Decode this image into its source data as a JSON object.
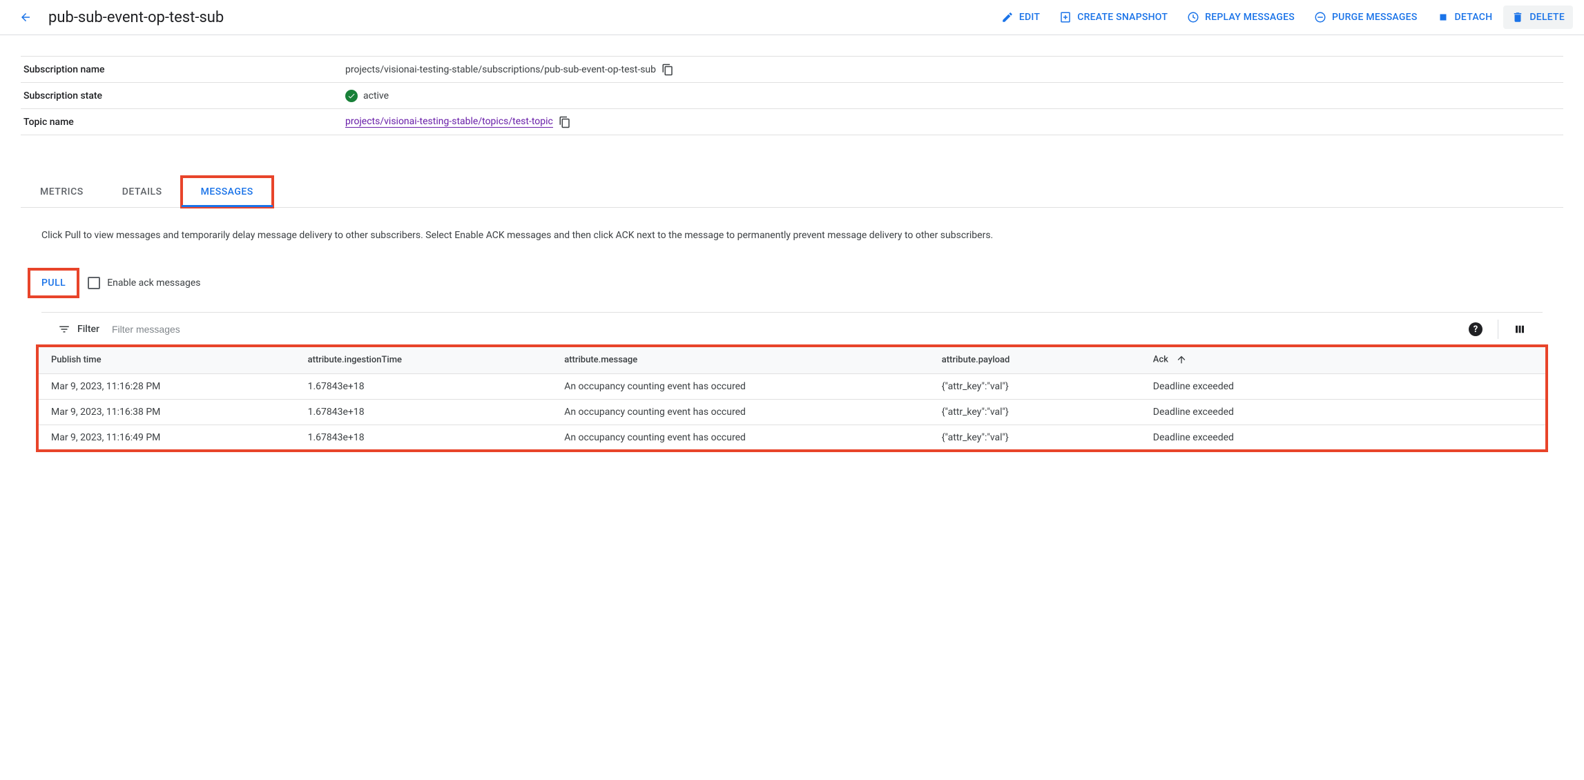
{
  "header": {
    "title": "pub-sub-event-op-test-sub",
    "actions": {
      "edit": "EDIT",
      "snapshot": "CREATE SNAPSHOT",
      "replay": "REPLAY MESSAGES",
      "purge": "PURGE MESSAGES",
      "detach": "DETACH",
      "delete": "DELETE"
    }
  },
  "details": {
    "subscription_name_label": "Subscription name",
    "subscription_name_value": "projects/visionai-testing-stable/subscriptions/pub-sub-event-op-test-sub",
    "subscription_state_label": "Subscription state",
    "subscription_state_value": "active",
    "topic_name_label": "Topic name",
    "topic_name_value": "projects/visionai-testing-stable/topics/test-topic"
  },
  "tabs": {
    "metrics": "METRICS",
    "details": "DETAILS",
    "messages": "MESSAGES"
  },
  "messages_tab": {
    "help_text": "Click Pull to view messages and temporarily delay message delivery to other subscribers. Select Enable ACK messages and then click ACK next to the message to permanently prevent message delivery to other subscribers.",
    "pull_label": "PULL",
    "enable_ack_label": "Enable ack messages",
    "filter_label": "Filter",
    "filter_placeholder": "Filter messages"
  },
  "table": {
    "headers": {
      "publish_time": "Publish time",
      "ingestion_time": "attribute.ingestionTime",
      "message": "attribute.message",
      "payload": "attribute.payload",
      "ack": "Ack"
    },
    "rows": [
      {
        "publish_time": "Mar 9, 2023, 11:16:28 PM",
        "ingestion_time": "1.67843e+18",
        "message": "An occupancy counting event has occured",
        "payload": "{\"attr_key\":\"val\"}",
        "ack": "Deadline exceeded"
      },
      {
        "publish_time": "Mar 9, 2023, 11:16:38 PM",
        "ingestion_time": "1.67843e+18",
        "message": "An occupancy counting event has occured",
        "payload": "{\"attr_key\":\"val\"}",
        "ack": "Deadline exceeded"
      },
      {
        "publish_time": "Mar 9, 2023, 11:16:49 PM",
        "ingestion_time": "1.67843e+18",
        "message": "An occupancy counting event has occured",
        "payload": "{\"attr_key\":\"val\"}",
        "ack": "Deadline exceeded"
      }
    ]
  }
}
